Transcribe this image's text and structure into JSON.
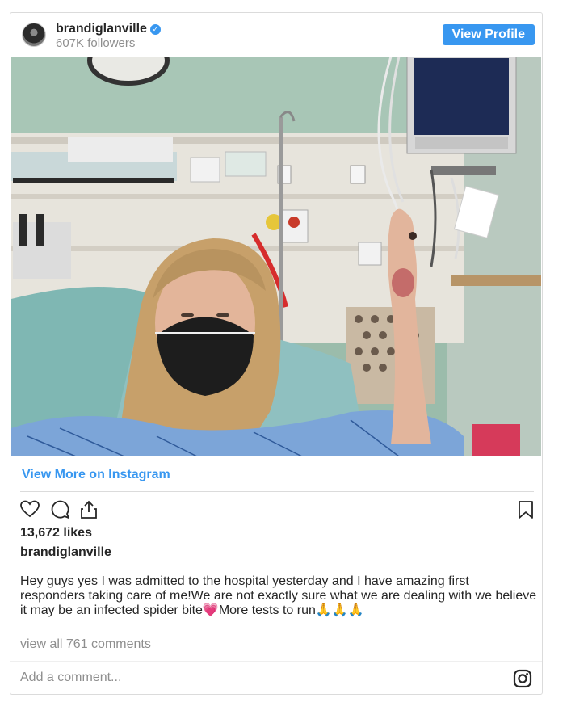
{
  "header": {
    "username": "brandiglanville",
    "verified_icon": "verified-badge-icon",
    "followers": "607K followers",
    "view_profile_label": "View Profile"
  },
  "post": {
    "image_description_icon": "hospital-selfie-photo",
    "view_more_label": "View More on Instagram",
    "likes": "13,672 likes",
    "caption_username": "brandiglanville",
    "caption_text": "Hey guys yes I was admitted to the hospital yesterday and I have amazing first responders taking care of me!We are not exactly sure what we are dealing with we believe it may be an infected spider bite💗More tests to run🙏🙏🙏",
    "comments_link": "view all 761 comments"
  },
  "comment_box": {
    "placeholder": "Add a comment..."
  },
  "colors": {
    "accent": "#3897f0",
    "text": "#262626",
    "muted": "#8e8e8e",
    "border": "#dbdbdb"
  }
}
